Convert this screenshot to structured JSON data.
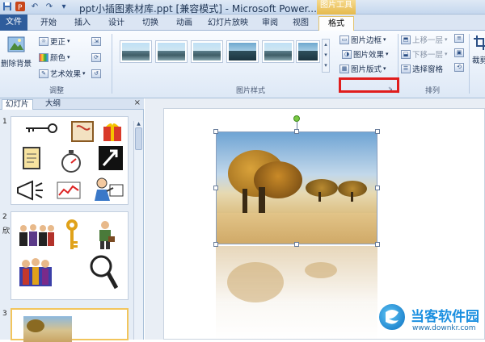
{
  "window": {
    "title": "ppt小插图素材库.ppt [兼容模式] - Microsoft Power..."
  },
  "quick_access": {
    "icons": [
      "save-icon",
      "undo-icon",
      "redo-icon",
      "customize-icon"
    ],
    "undo_glyph": "↶",
    "redo_glyph": "↷"
  },
  "context_tab_group": "图片工具",
  "tabs": [
    "文件",
    "开始",
    "插入",
    "设计",
    "切换",
    "动画",
    "幻灯片放映",
    "审阅",
    "视图",
    "格式"
  ],
  "ribbon": {
    "adjust": {
      "remove_bg": "删除背景",
      "corrections": "更正",
      "color": "颜色",
      "artistic": "艺术效果",
      "label": "调整"
    },
    "picture_styles": {
      "border": "图片边框",
      "effects": "图片效果",
      "layout": "图片版式",
      "label": "图片样式"
    },
    "arrange": {
      "bring_forward": "上移一层",
      "send_backward": "下移一层",
      "selection_pane": "选择窗格",
      "label": "排列"
    },
    "crop": {
      "label": "裁剪"
    }
  },
  "left_panel": {
    "tabs": [
      "幻灯片",
      "大纲"
    ],
    "close": "×",
    "slide_numbers": [
      "1",
      "2",
      "3"
    ],
    "slide2_note": "欣"
  },
  "watermark": {
    "name": "当客软件园",
    "url": "www.downkr.com"
  },
  "colors": {
    "accent": "#2f5d9c",
    "highlight": "#e01d1d",
    "selected_thumb": "#f2c55c"
  }
}
